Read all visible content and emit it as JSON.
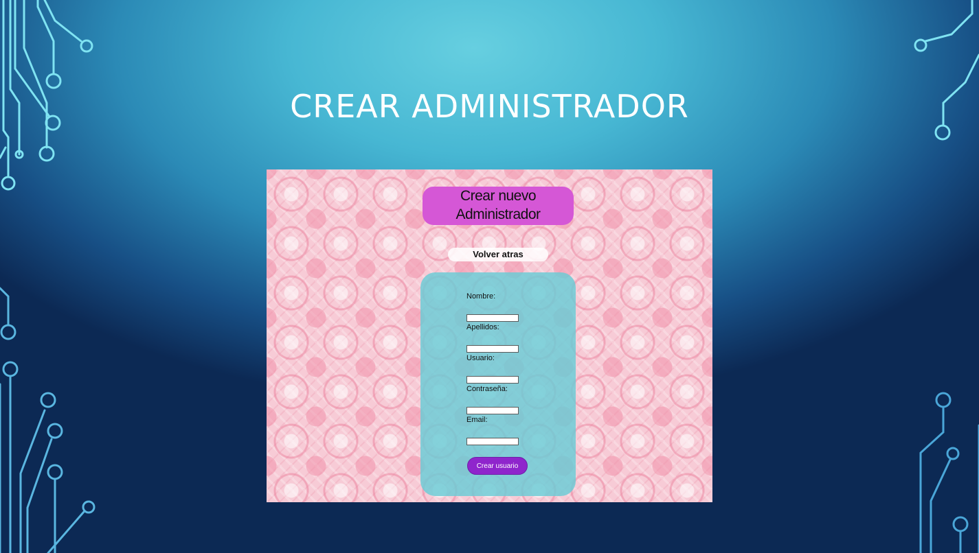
{
  "slide": {
    "title": "CREAR ADMINISTRADOR"
  },
  "app": {
    "heading_line1": "Crear nuevo",
    "heading_line2": "Administrador",
    "back_link": "Volver atras",
    "form": {
      "fields": [
        {
          "label": "Nombre:",
          "value": ""
        },
        {
          "label": "Apellidos:",
          "value": ""
        },
        {
          "label": "Usuario:",
          "value": ""
        },
        {
          "label": "Contraseña:",
          "value": ""
        },
        {
          "label": "Email:",
          "value": ""
        }
      ],
      "submit_label": "Crear usuario"
    }
  },
  "colors": {
    "heading_bg": "#d557d6",
    "panel_bg": "#69ccd6",
    "button_bg": "#8f25cc",
    "circuit_light": "#7fe3f2",
    "circuit_dark": "#4aa6d8"
  }
}
